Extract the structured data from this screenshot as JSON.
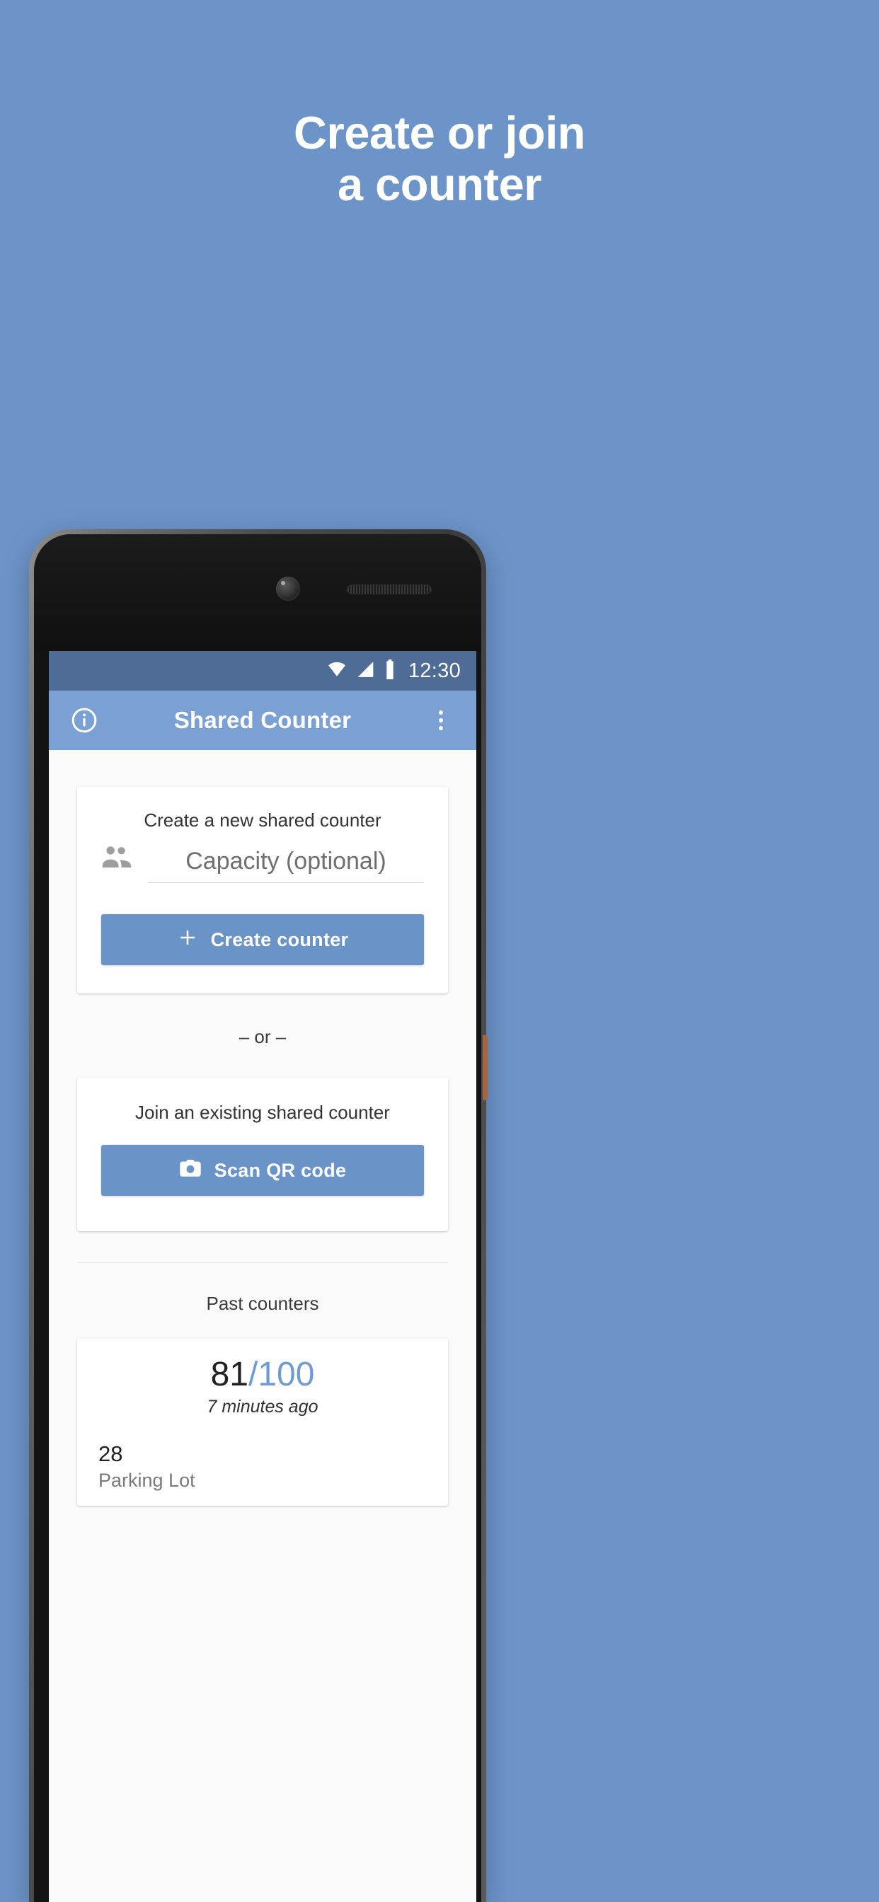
{
  "promo": {
    "headline_line1": "Create or join",
    "headline_line2": "a counter",
    "background_color": "#6d94c9",
    "text_color": "#ffffff"
  },
  "device": {
    "icons": {
      "front_camera": "camera-icon",
      "earpiece": "speaker-grille-icon"
    }
  },
  "status_bar": {
    "clock": "12:30",
    "background_color": "#4e6c95",
    "icons": [
      "wifi-icon",
      "signal-icon",
      "battery-icon"
    ]
  },
  "app_bar": {
    "title": "Shared Counter",
    "background_color": "#7ba1d4",
    "info_icon": "info-icon",
    "overflow_icon": "more-vertical-icon"
  },
  "create_card": {
    "heading": "Create a new shared counter",
    "leading_icon": "people-icon",
    "capacity_placeholder": "Capacity (optional)",
    "capacity_value": "",
    "button_label": "Create counter",
    "button_icon": "plus-icon",
    "button_color": "#6a93c8"
  },
  "separator": {
    "label": "– or –"
  },
  "join_card": {
    "heading": "Join an existing shared counter",
    "button_label": "Scan QR code",
    "button_icon": "camera-photo-icon",
    "button_color": "#6a93c8"
  },
  "past_counters": {
    "heading": "Past counters",
    "items": [
      {
        "count": "81",
        "separator": "/",
        "capacity": "100",
        "timestamp": "7 minutes ago",
        "capacity_color": "#6f9ad2",
        "rows": [
          {
            "value": "28",
            "label": "Parking Lot"
          }
        ]
      }
    ]
  }
}
